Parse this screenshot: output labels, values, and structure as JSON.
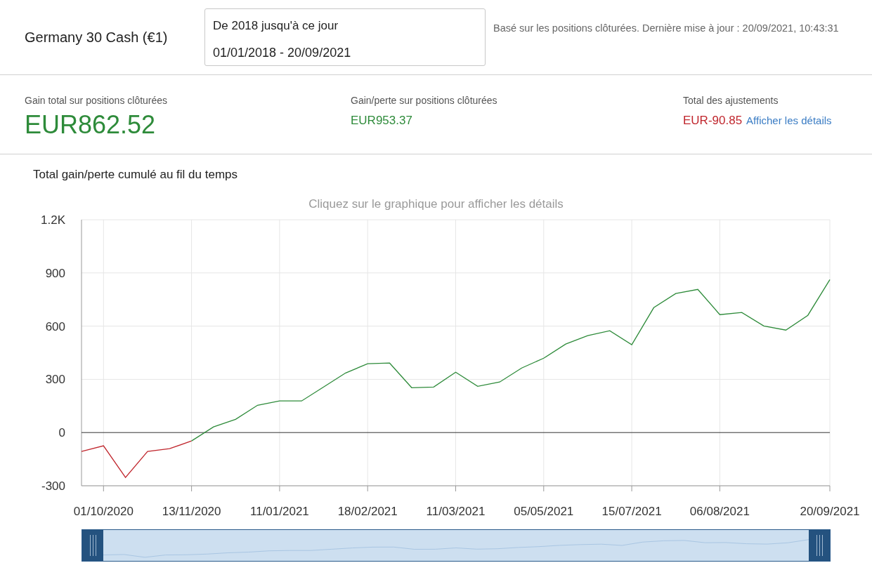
{
  "header": {
    "instrument": "Germany 30 Cash (€1)",
    "date_range": {
      "label": "De 2018 jusqu'à ce jour",
      "value": "01/01/2018 - 20/09/2021"
    },
    "note": "Basé sur les positions clôturées. Dernière mise à jour : 20/09/2021, 10:43:31"
  },
  "stats": [
    {
      "label": "Gain total sur positions clôturées",
      "value": "EUR862.52",
      "kind": "large",
      "color": "#2e8b3a"
    },
    {
      "label": "Gain/perte sur positions clôturées",
      "value": "EUR953.37",
      "kind": "small",
      "color": "#2e8b3a"
    },
    {
      "label": "Total des ajustements",
      "value": "EUR-90.85",
      "kind": "small",
      "color": "#c0262d",
      "link": "Afficher les détails"
    }
  ],
  "chart": {
    "title": "Total gain/perte cumulé au fil du temps",
    "hint": "Cliquez sur le graphique pour afficher les détails",
    "chart_data": {
      "type": "line",
      "categories": [
        null,
        "01/10/2020",
        null,
        null,
        null,
        "13/11/2020",
        null,
        null,
        null,
        "11/01/2021",
        null,
        null,
        null,
        "18/02/2021",
        null,
        null,
        null,
        "11/03/2021",
        null,
        null,
        null,
        "05/05/2021",
        null,
        null,
        null,
        "15/07/2021",
        null,
        null,
        null,
        "06/08/2021",
        null,
        null,
        null,
        null,
        "20/09/2021"
      ],
      "series": [
        {
          "color": "#c0262d",
          "values": [
            -107,
            -75,
            -253,
            -107,
            -91,
            -47,
            null,
            null,
            null,
            null,
            null,
            null,
            null,
            null,
            null,
            null,
            null,
            null,
            null,
            null,
            null,
            null,
            null,
            null,
            null,
            null,
            null,
            null,
            null,
            null,
            null,
            null,
            null,
            null,
            null
          ]
        },
        {
          "color": "#2e8b3a",
          "values": [
            null,
            null,
            null,
            null,
            null,
            -47,
            32,
            75,
            154,
            178,
            178,
            257,
            336,
            388,
            392,
            253,
            257,
            340,
            261,
            285,
            364,
            419,
            499,
            546,
            574,
            495,
            704,
            784,
            807,
            665,
            677,
            601,
            578,
            661,
            862
          ]
        }
      ],
      "ylim": [
        -300,
        1200
      ],
      "grid": true,
      "yticks": [
        {
          "value": -300,
          "label": "-300"
        },
        {
          "value": 0,
          "label": "0"
        },
        {
          "value": 300,
          "label": "300"
        },
        {
          "value": 600,
          "label": "600"
        },
        {
          "value": 900,
          "label": "900"
        },
        {
          "value": 1200,
          "label": "1.2K"
        }
      ]
    }
  }
}
